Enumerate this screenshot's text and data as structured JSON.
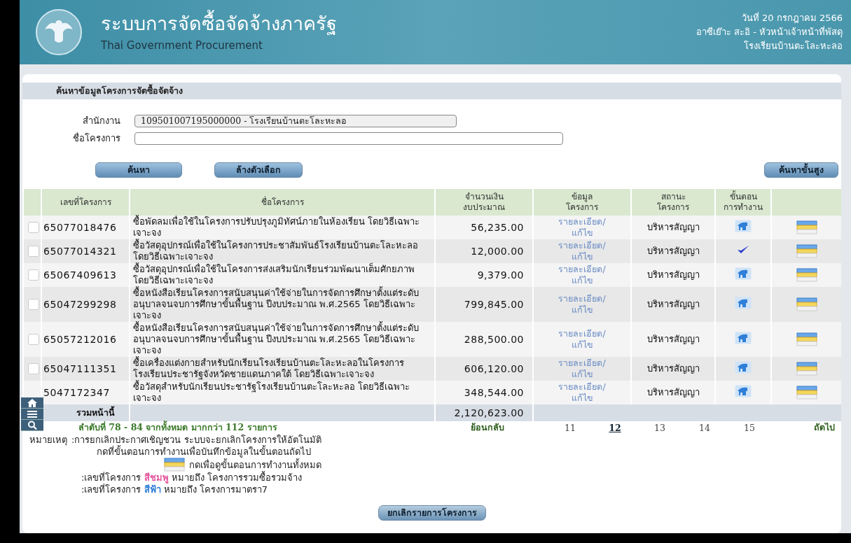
{
  "header": {
    "title": "ระบบการจัดซื้อจัดจ้างภาครัฐ",
    "subtitle": "Thai Government Procurement",
    "date": "วันที่ 20 กรกฎาคม 2566",
    "user": "อาซีเย๊าะ สะอิ - หัวหน้าเจ้าหน้าที่พัสดุ",
    "org": "โรงเรียนบ้านตะโละหะลอ"
  },
  "search": {
    "title": "ค้นหาข้อมูลโครงการจัดซื้อจัดจ้าง",
    "fields": [
      {
        "label": "สำนักงาน",
        "value": "109501007195000000 - โรงเรียนบ้านตะโละหะลอ",
        "disabled": true
      },
      {
        "label": "ชื่อโครงการ",
        "disabled": false
      }
    ],
    "buttons": [
      "ค้นหา",
      "ล้างตัวเลือก"
    ],
    "advanced_button": "ค้นหาขั้นสูง"
  },
  "table": {
    "columns": [
      [
        "เลขที่โครงการ"
      ],
      [
        "ชื่อโครงการ"
      ],
      [
        "จำนวนเงิน",
        "งบประมาณ"
      ],
      [
        "ข้อมูล",
        "โครงการ"
      ],
      [
        "สถานะ",
        "โครงการ"
      ],
      [
        "ขั้นตอน",
        "การทำงาน"
      ]
    ],
    "rows": [
      {
        "checked": false,
        "number": "65077018476",
        "name": "ซื้อพัดลมเพื่อใช้ในโครงการปรับปรุงภูมิทัศน์ภายในห้องเรียน โดยวิธีเฉพาะเจาะจง",
        "amount": "56,235.00",
        "link": [
          "รายละเอียด/",
          "แก้ไข"
        ],
        "status": "บริหารสัญญา",
        "step": {
          "kind": "stamp"
        }
      },
      {
        "checked": false,
        "number": "65077014321",
        "name": "ซื้อวัสดุอุปกรณ์เพื่อใช้ในโครงการประชาสัมพันธ์โรงเรียนบ้านตะโละหะลอ โดยวิธีเฉพาะเจาะจง",
        "amount": "12,000.00",
        "link": [
          "รายละเอียด/",
          "แก้ไข"
        ],
        "status": "บริหารสัญญา",
        "step": {
          "kind": "check"
        }
      },
      {
        "checked": false,
        "number": "65067409613",
        "name": "ซื้อวัสดุอุปกรณ์เพื่อใช้ในโครงการส่งเสริมนักเรียนร่วมพัฒนาเต็มศักยภาพ โดยวิธีเฉพาะเจาะจง",
        "amount": "9,379.00",
        "link": [
          "รายละเอียด/",
          "แก้ไข"
        ],
        "status": "บริหารสัญญา",
        "step": {
          "kind": "stamp"
        }
      },
      {
        "checked": false,
        "number": "65047299298",
        "name": "ซื้อหนังสือเรียนโครงการสนับสนุนค่าใช้จ่ายในการจัดการศึกษาตั้งแต่ระดับอนุบาลจนจบการศึกษาขั้นพื้นฐาน ปีงบประมาณ พ.ศ.2565 โดยวิธีเฉพาะเจาะจง",
        "amount": "799,845.00",
        "link": [
          "รายละเอียด/",
          "แก้ไข"
        ],
        "status": "บริหารสัญญา",
        "step": {
          "kind": "stamp"
        }
      },
      {
        "checked": false,
        "number": "65057212016",
        "name": "ซื้อหนังสือเรียนโครงการสนับสนุนค่าใช้จ่ายในการจัดการศึกษาตั้งแต่ระดับอนุบาลจนจบการศึกษาขั้นพื้นฐาน ปีงบประมาณ พ.ศ.2565 โดยวิธีเฉพาะเจาะจง",
        "amount": "288,500.00",
        "link": [
          "รายละเอียด/",
          "แก้ไข"
        ],
        "status": "บริหารสัญญา",
        "step": {
          "kind": "stamp"
        }
      },
      {
        "checked": false,
        "number": "65047111351",
        "name": "ซื้อเครื่องแต่งกายสำหรับนักเรียนโรงเรียนบ้านตะโละหะลอในโครงการโรงเรียนประชารัฐจังหวัดชายแดนภาคใต้ โดยวิธีเฉพาะเจาะจง",
        "amount": "606,120.00",
        "link": [
          "รายละเอียด/",
          "แก้ไข"
        ],
        "status": "บริหารสัญญา",
        "step": {
          "kind": "stamp"
        }
      },
      {
        "number": "5047172347",
        "name": "ซื้อวัสดุสำหรับนักเรียนประชารัฐโรงเรียนบ้านตะโละหะลอ โดยวิธีเฉพาะเจาะจง",
        "amount": "348,544.00",
        "link": [
          "รายละเอียด/",
          "แก้ไข"
        ],
        "status": "บริหารสัญญา",
        "step": {
          "kind": "stamp"
        }
      }
    ],
    "total_label": "รวมหน้านี้",
    "total": "2,120,623.00"
  },
  "pager": {
    "info": "ลำดับที่ 78 - 84 จากทั้งหมด มากกว่า 112 รายการ",
    "prev": "ย้อนกลับ",
    "pages": [
      {
        "label": "11",
        "selected": false
      },
      {
        "label": "12",
        "selected": true
      },
      {
        "label": "13",
        "selected": false
      },
      {
        "label": "14",
        "selected": false
      },
      {
        "label": "15",
        "selected": false
      }
    ],
    "next": "ถัดไป"
  },
  "notes": {
    "label": "หมายเหตุ",
    "lines": [
      {
        "kind": "text",
        "parts": [
          {
            "text": ":การยกเลิกประกาศเชิญชวน ระบบจะยกเลิกโครงการให้อัตโนมัติ"
          }
        ]
      },
      {
        "kind": "text",
        "parts": [
          {
            "text": "กดที่ขั้นตอนการทำงานเพื่อบันทึกข้อมูลในขั้นตอนถัดไป"
          }
        ]
      },
      {
        "kind": "icon",
        "parts": [
          {
            "text": "กดเพื่อดูขั้นตอนการทำงานทั้งหมด"
          }
        ]
      },
      {
        "kind": "text",
        "parts": [
          {
            "text": ":เลขที่โครงการ "
          },
          {
            "text": "สีชมพู",
            "color": "#e2559c"
          },
          {
            "text": " หมายถึง โครงการรวมซื้อรวมจ้าง"
          }
        ]
      },
      {
        "kind": "text",
        "parts": [
          {
            "text": ":เลขที่โครงการ "
          },
          {
            "text": "สีฟ้า",
            "color": "#2f7fd8"
          },
          {
            "text": " หมายถึง โครงการมาตรา7"
          }
        ]
      }
    ]
  },
  "cancel_button": "ยกเลิกรายการโครงการ"
}
